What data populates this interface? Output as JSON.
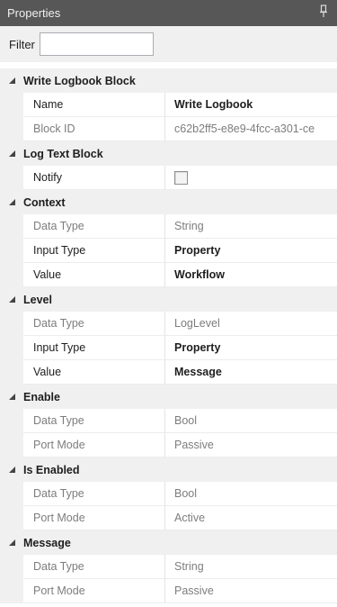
{
  "panel": {
    "title": "Properties"
  },
  "filter": {
    "label": "Filter",
    "value": ""
  },
  "categories": [
    {
      "title": "Write Logbook Block",
      "rows": [
        {
          "name": "Name",
          "value": "Write Logbook",
          "bold": true,
          "dim": false
        },
        {
          "name": "Block ID",
          "value": "c62b2ff5-e8e9-4fcc-a301-ce",
          "bold": false,
          "dim": true
        }
      ]
    },
    {
      "title": "Log Text Block",
      "rows": [
        {
          "name": "Notify",
          "value": "",
          "checkbox": true,
          "checked": false,
          "bold": false,
          "dim": false
        }
      ]
    },
    {
      "title": "Context",
      "rows": [
        {
          "name": "Data Type",
          "value": "String",
          "bold": false,
          "dim": true
        },
        {
          "name": "Input Type",
          "value": "Property",
          "bold": true,
          "dim": false
        },
        {
          "name": "Value",
          "value": "Workflow",
          "bold": true,
          "dim": false
        }
      ]
    },
    {
      "title": "Level",
      "rows": [
        {
          "name": "Data Type",
          "value": "LogLevel",
          "bold": false,
          "dim": true
        },
        {
          "name": "Input Type",
          "value": "Property",
          "bold": true,
          "dim": false
        },
        {
          "name": "Value",
          "value": "Message",
          "bold": true,
          "dim": false
        }
      ]
    },
    {
      "title": "Enable",
      "rows": [
        {
          "name": "Data Type",
          "value": "Bool",
          "bold": false,
          "dim": true
        },
        {
          "name": "Port Mode",
          "value": "Passive",
          "bold": false,
          "dim": true
        }
      ]
    },
    {
      "title": "Is Enabled",
      "rows": [
        {
          "name": "Data Type",
          "value": "Bool",
          "bold": false,
          "dim": true
        },
        {
          "name": "Port Mode",
          "value": "Active",
          "bold": false,
          "dim": true
        }
      ]
    },
    {
      "title": "Message",
      "rows": [
        {
          "name": "Data Type",
          "value": "String",
          "bold": false,
          "dim": true
        },
        {
          "name": "Port Mode",
          "value": "Passive",
          "bold": false,
          "dim": true
        }
      ]
    }
  ],
  "icons": {
    "pin": "pin-icon",
    "collapse": "collapse-triangle-icon"
  },
  "colors": {
    "titlebar": "#575757",
    "category_bg": "#f0f0f0",
    "dim_text": "#7d7d7d"
  }
}
